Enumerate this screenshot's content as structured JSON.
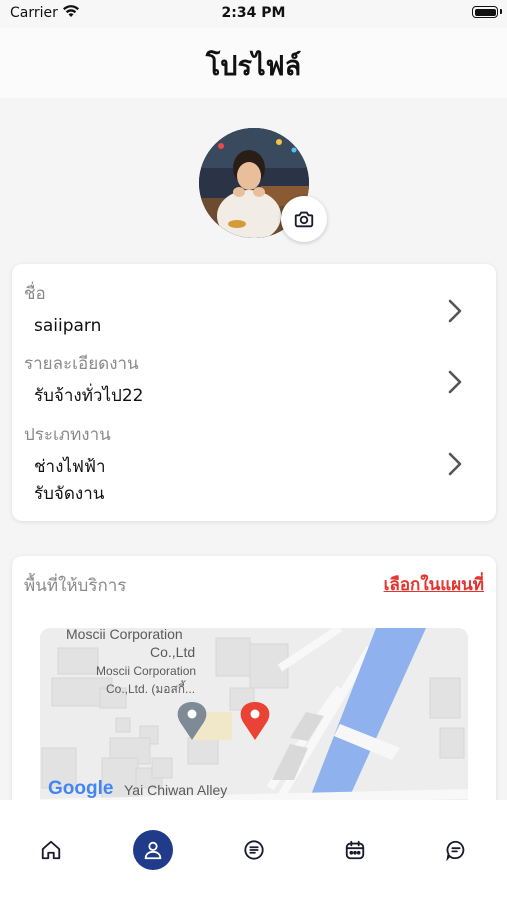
{
  "status_bar": {
    "carrier": "Carrier",
    "time": "2:34 PM",
    "wifi_icon": "wifi-icon",
    "battery_icon": "battery-icon"
  },
  "header": {
    "title": "โปรไฟล์"
  },
  "avatar": {
    "icon": "camera-icon"
  },
  "profile": {
    "rows": [
      {
        "label": "ชื่อ",
        "values": [
          "saiiparn"
        ]
      },
      {
        "label": "รายละเอียดงาน",
        "values": [
          "รับจ้างทั่วไป22"
        ]
      },
      {
        "label": "ประเภทงาน",
        "values": [
          "ช่างไฟฟ้า",
          "รับจัดงาน"
        ]
      }
    ]
  },
  "service_area": {
    "label": "พื้นที่ให้บริการ",
    "map_link": "เลือกในแผนที่",
    "map": {
      "poi_name_line1": "Moscii Corporation",
      "poi_name_line2": "Co.,Ltd",
      "poi_sub_line1": "Moscii Corporation",
      "poi_sub_line2": "Co.,Ltd. (มอสกี้...",
      "road_label": "Yai Chiwan Alley",
      "attribution": "Google"
    }
  },
  "tabbar": {
    "tabs": [
      {
        "icon": "home-icon",
        "active": false
      },
      {
        "icon": "user-icon",
        "active": true
      },
      {
        "icon": "list-icon",
        "active": false
      },
      {
        "icon": "calendar-icon",
        "active": false
      },
      {
        "icon": "chat-icon",
        "active": false
      }
    ]
  },
  "colors": {
    "accent": "#1f3b8a",
    "link": "#e3342f",
    "pin": "#ea4335",
    "water": "#8fb2ef"
  }
}
